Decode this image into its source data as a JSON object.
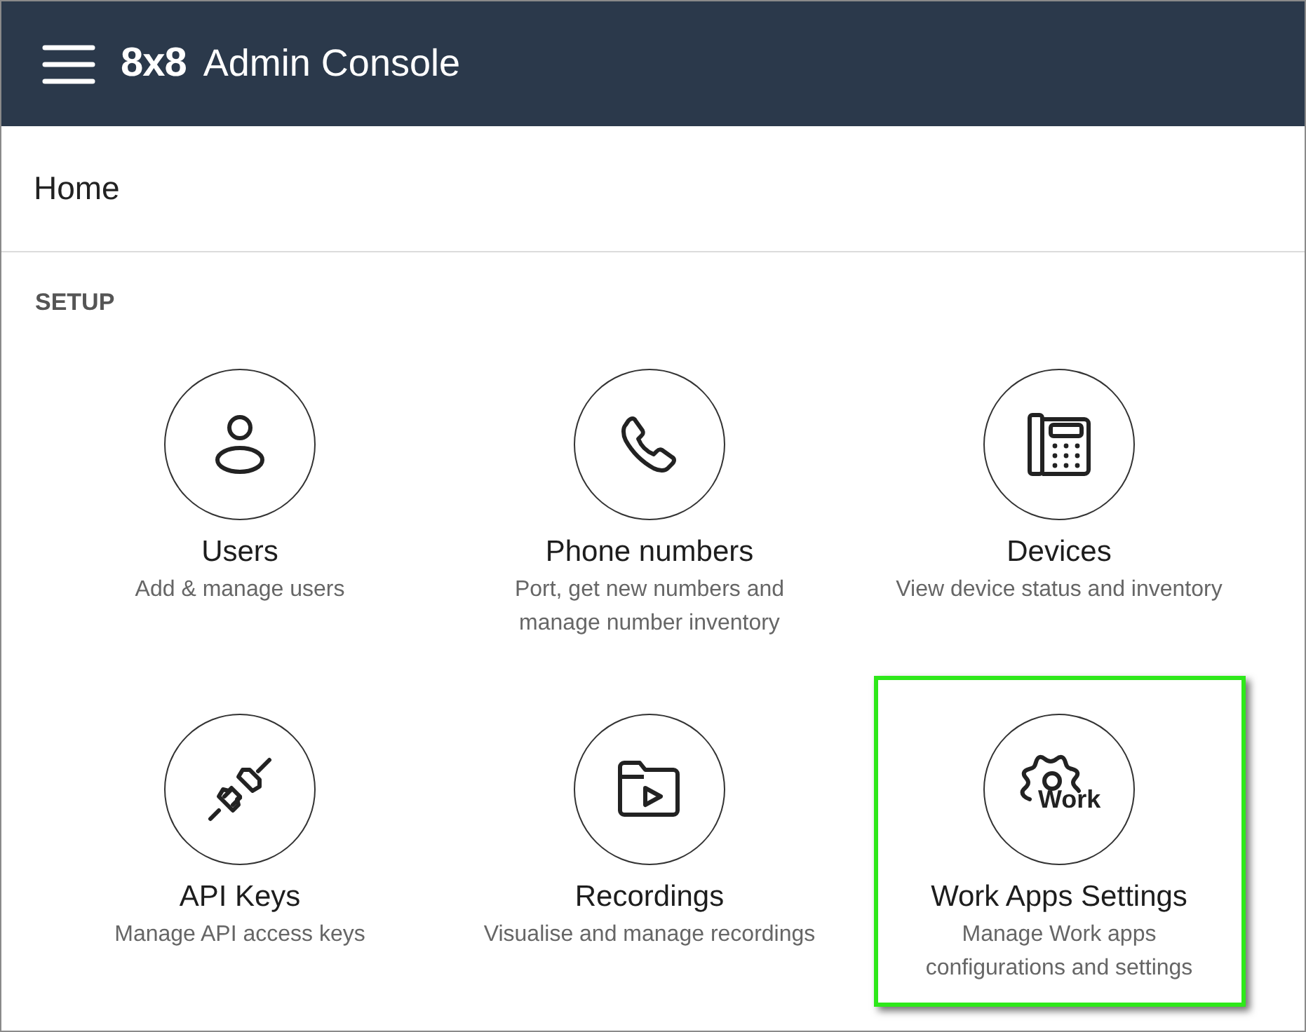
{
  "header": {
    "logo": "8x8",
    "title": "Admin Console"
  },
  "page": {
    "title": "Home"
  },
  "section": {
    "title": "SETUP"
  },
  "tiles": [
    {
      "kind": "users",
      "title": "Users",
      "description_lines": [
        "Add & manage users"
      ],
      "highlighted": false
    },
    {
      "kind": "phone",
      "title": "Phone numbers",
      "description_lines": [
        "Port, get new numbers and",
        "manage number inventory"
      ],
      "highlighted": false
    },
    {
      "kind": "devices",
      "title": "Devices",
      "description_lines": [
        "View device status and inventory"
      ],
      "highlighted": false
    },
    {
      "kind": "api",
      "title": "API Keys",
      "description_lines": [
        "Manage API access keys"
      ],
      "highlighted": false
    },
    {
      "kind": "recordings",
      "title": "Recordings",
      "description_lines": [
        "Visualise and manage recordings"
      ],
      "highlighted": false
    },
    {
      "kind": "work",
      "title": "Work Apps Settings",
      "icon_label": "Work",
      "description_lines": [
        "Manage Work apps",
        "configurations and settings"
      ],
      "highlighted": true
    }
  ]
}
